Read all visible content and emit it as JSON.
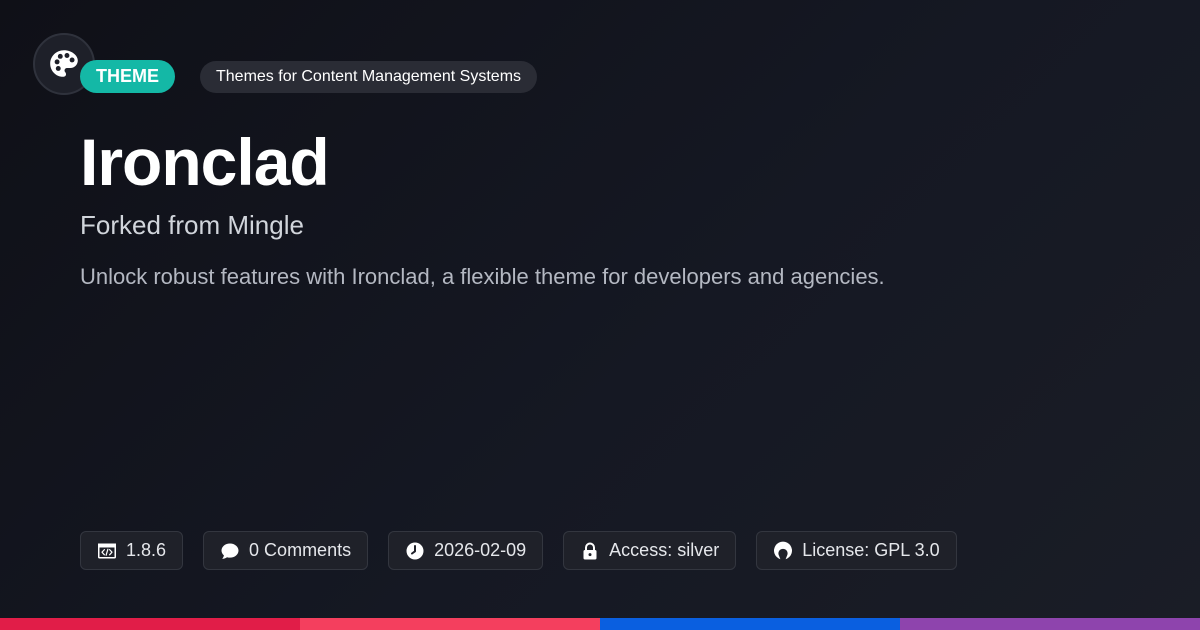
{
  "logo": {
    "icon": "palette-icon"
  },
  "badge": {
    "label": "THEME",
    "color": "#14b8a6"
  },
  "category": {
    "label": "Themes for Content Management Systems"
  },
  "title": "Ironclad",
  "subtitle": "Forked from Mingle",
  "description": "Unlock robust features with Ironclad, a flexible theme for developers and agencies.",
  "meta": [
    {
      "icon": "code-icon",
      "label": "1.8.6"
    },
    {
      "icon": "comment-icon",
      "label": "0 Comments"
    },
    {
      "icon": "clock-icon",
      "label": "2026-02-09"
    },
    {
      "icon": "lock-icon",
      "label": "Access: silver"
    },
    {
      "icon": "open-source-icon",
      "label": "License: GPL 3.0"
    }
  ],
  "bottom_bar_colors": [
    "#e11d48",
    "#f43f5e",
    "#0a5fe0",
    "#8e44ad"
  ]
}
